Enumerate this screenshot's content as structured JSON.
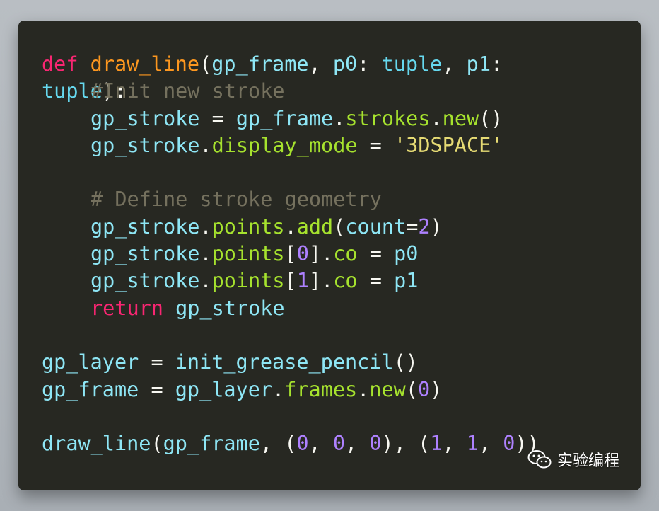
{
  "colors": {
    "editor_background": "#272822",
    "keyword": "#f92672",
    "function_name": "#fd971f",
    "identifier": "#8ee6f5",
    "attribute": "#a6e22e",
    "number": "#ae81ff",
    "string": "#e6db74",
    "comment": "#75715e"
  },
  "code": {
    "l1": {
      "def": "def",
      "fname": "draw_line",
      "open": "(",
      "p1": "gp_frame",
      "comma1": ", ",
      "p2": "p0",
      "colon1": ": ",
      "t1": "tuple",
      "comma2": ", ",
      "p3": "p1",
      "colon2": ":"
    },
    "l2": {
      "t2": "tuple",
      "close": "):",
      "comment": "#Init new stroke"
    },
    "l3": {
      "a": "gp_stroke",
      "eq": " = ",
      "b": "gp_frame",
      "dot1": ".",
      "c": "strokes",
      "dot2": ".",
      "d": "new",
      "e": "()"
    },
    "l4": {
      "a": "gp_stroke",
      "dot": ".",
      "b": "display_mode",
      "eq": " = ",
      "c": "'3DSPACE'"
    },
    "l6": {
      "comment": "# Define stroke geometry"
    },
    "l7": {
      "a": "gp_stroke",
      "dot1": ".",
      "b": "points",
      "dot2": ".",
      "c": "add",
      "open": "(",
      "d": "count",
      "eq": "=",
      "n": "2",
      "close": ")"
    },
    "l8": {
      "a": "gp_stroke",
      "dot1": ".",
      "b": "points",
      "ob": "[",
      "n": "0",
      "cb": "]",
      "dot2": ".",
      "c": "co",
      "eq": " = ",
      "d": "p0"
    },
    "l9": {
      "a": "gp_stroke",
      "dot1": ".",
      "b": "points",
      "ob": "[",
      "n": "1",
      "cb": "]",
      "dot2": ".",
      "c": "co",
      "eq": " = ",
      "d": "p1"
    },
    "l10": {
      "ret": "return",
      "sp": " ",
      "a": "gp_stroke"
    },
    "l12": {
      "a": "gp_layer",
      "eq": " = ",
      "b": "init_grease_pencil",
      "c": "()"
    },
    "l13": {
      "a": "gp_frame",
      "eq": " = ",
      "b": "gp_layer",
      "dot1": ".",
      "c": "frames",
      "dot2": ".",
      "d": "new",
      "open": "(",
      "n": "0",
      "close": ")"
    },
    "l15": {
      "a": "draw_line",
      "open": "(",
      "b": "gp_frame",
      "c1": ", (",
      "n1": "0",
      "c2": ", ",
      "n2": "0",
      "c3": ", ",
      "n3": "0",
      "c4": "), (",
      "n4": "1",
      "c5": ", ",
      "n5": "1",
      "c6": ", ",
      "n6": "0",
      "close": "))"
    }
  },
  "watermark": {
    "icon": "wechat-icon",
    "text": "实验编程"
  }
}
